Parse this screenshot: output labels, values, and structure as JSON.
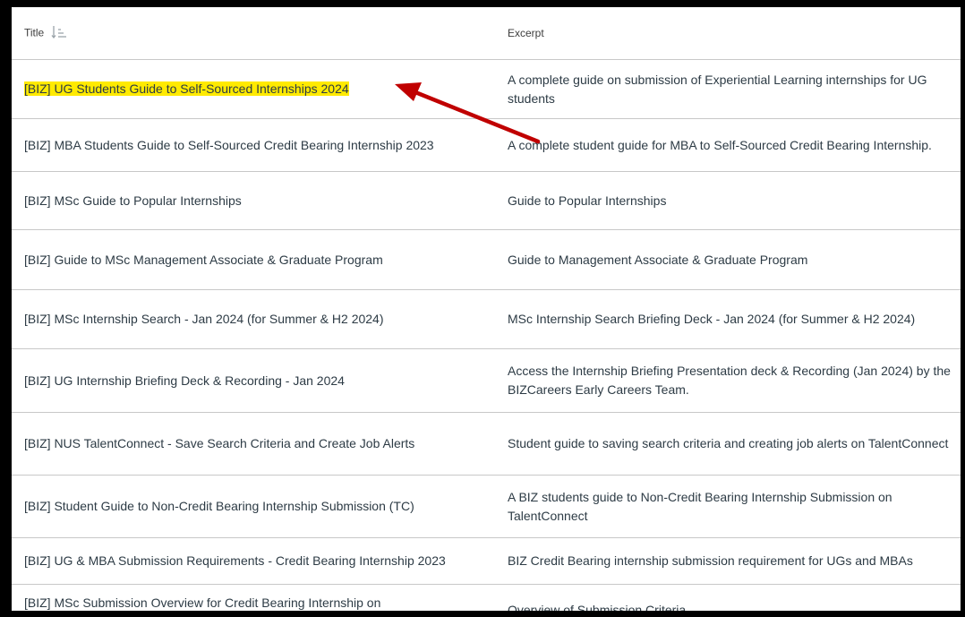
{
  "table": {
    "headers": {
      "title": "Title",
      "excerpt": "Excerpt"
    },
    "rows": [
      {
        "title": "[BIZ] UG Students Guide to Self-Sourced Internships 2024",
        "excerpt": "A complete guide on submission of Experiential Learning internships for UG students",
        "highlighted": true
      },
      {
        "title": "[BIZ] MBA Students Guide to Self-Sourced Credit Bearing Internship 2023",
        "excerpt": "A complete student guide for MBA to Self-Sourced Credit Bearing Internship."
      },
      {
        "title": "[BIZ] MSc Guide to Popular Internships",
        "excerpt": "Guide to Popular Internships"
      },
      {
        "title": "[BIZ] Guide to MSc Management Associate & Graduate Program",
        "excerpt": "Guide to Management Associate & Graduate Program"
      },
      {
        "title": "[BIZ] MSc Internship Search - Jan 2024 (for Summer & H2 2024)",
        "excerpt": "MSc Internship Search Briefing Deck - Jan 2024 (for Summer & H2 2024)"
      },
      {
        "title": "[BIZ] UG Internship Briefing Deck & Recording - Jan 2024",
        "excerpt": "Access the Internship Briefing Presentation deck & Recording (Jan 2024) by the BIZCareers Early Careers Team."
      },
      {
        "title": "[BIZ] NUS TalentConnect - Save Search Criteria and Create Job Alerts",
        "excerpt": "Student guide to saving search criteria and creating job alerts on TalentConnect"
      },
      {
        "title": "[BIZ] Student Guide to Non-Credit Bearing Internship Submission (TC)",
        "excerpt": "A BIZ students guide to Non-Credit Bearing Internship Submission on TalentConnect"
      },
      {
        "title": "[BIZ] UG & MBA Submission Requirements - Credit Bearing Internship 2023",
        "excerpt": "BIZ Credit Bearing internship submission requirement for UGs and MBAs"
      },
      {
        "title": "[BIZ] MSc Submission Overview for Credit Bearing Internship on",
        "excerpt": "Overview of Submission Criteria"
      }
    ]
  },
  "colors": {
    "highlight": "#ffea00",
    "arrow": "#c00000",
    "text": "#2d3b45"
  }
}
